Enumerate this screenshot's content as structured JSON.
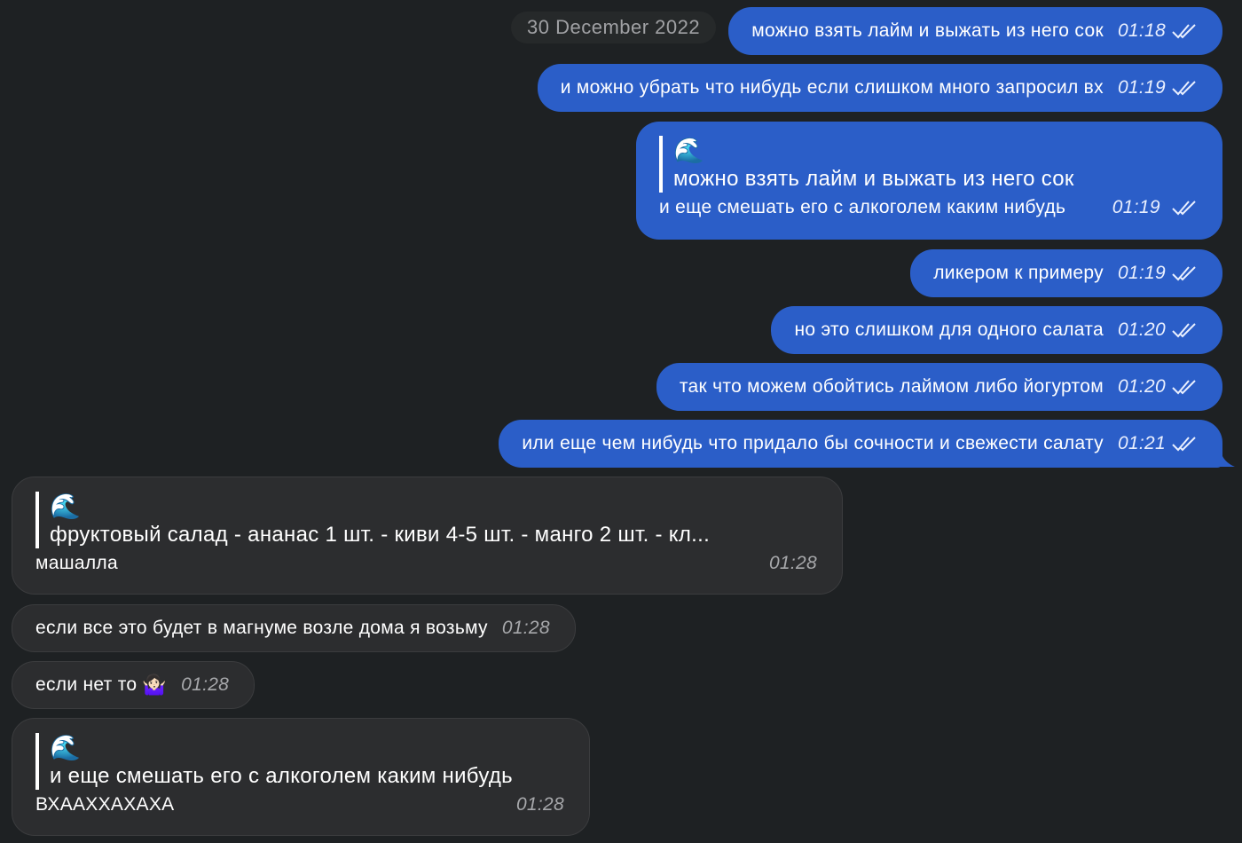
{
  "date_separator": "30 December 2022",
  "outgoing": [
    {
      "text": "можно взять лайм и выжать из него сок",
      "time": "01:18"
    },
    {
      "text": "и можно убрать что нибудь если слишком много запросил вх",
      "time": "01:19"
    },
    {
      "quote_icon": "🌊",
      "quote_text": "можно взять лайм и выжать из него сок",
      "text": "и еще смешать его с алкоголем каким нибудь",
      "time": "01:19"
    },
    {
      "text": "ликером к примеру",
      "time": "01:19"
    },
    {
      "text": "но это слишком для одного салата",
      "time": "01:20"
    },
    {
      "text": "так что можем обойтись лаймом либо йогуртом",
      "time": "01:20"
    },
    {
      "text": "или еще чем нибудь что придало бы сочности и свежести салату",
      "time": "01:21"
    }
  ],
  "incoming": [
    {
      "quote_icon": "🌊",
      "quote_text": "фруктовый салад  - ананас 1 шт.  - киви 4-5 шт.  - манго 2 шт.   - кл...",
      "text": "машалла",
      "time": "01:28"
    },
    {
      "text": "если все это будет в магнуме возле дома я возьму",
      "time": "01:28"
    },
    {
      "text": "если нет то",
      "emoji": "🤷🏻‍♀️",
      "time": "01:28"
    },
    {
      "quote_icon": "🌊",
      "quote_text": "и еще смешать его с алкоголем каким нибудь",
      "text": "ВХААХХАХАХА",
      "time": "01:28"
    }
  ],
  "colors": {
    "background": "#1e2123",
    "outgoing_bubble": "#2b5ec8",
    "incoming_bubble": "#2c2d2f"
  },
  "icons": {
    "read_receipt": "double-check-icon",
    "quote": "wave-emoji"
  }
}
